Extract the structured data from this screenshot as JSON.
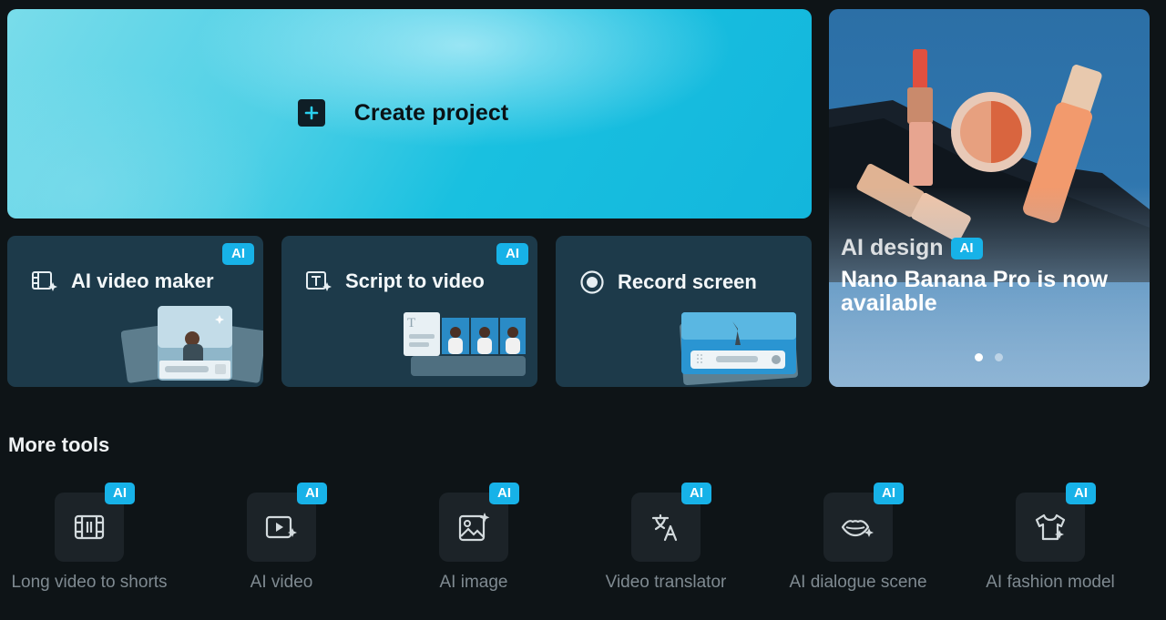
{
  "create": {
    "label": "Create project"
  },
  "cards": [
    {
      "title": "AI video maker",
      "badge": "AI",
      "icon": "film-sparkle-icon"
    },
    {
      "title": "Script to video",
      "badge": "AI",
      "icon": "text-sparkle-icon"
    },
    {
      "title": "Record screen",
      "icon": "record-icon"
    }
  ],
  "promo": {
    "tag": "AI design",
    "badge": "AI",
    "heading": "Nano Banana Pro is now available",
    "slide_count": 2,
    "active_slide": 1
  },
  "more_tools": {
    "title": "More tools",
    "items": [
      {
        "label": "Long video to shorts",
        "badge": "AI",
        "icon": "film-strip-icon"
      },
      {
        "label": "AI video",
        "badge": "AI",
        "icon": "video-play-sparkle-icon"
      },
      {
        "label": "AI image",
        "badge": "AI",
        "icon": "image-sparkle-icon"
      },
      {
        "label": "Video translator",
        "badge": "AI",
        "icon": "translate-icon"
      },
      {
        "label": "AI dialogue scene",
        "badge": "AI",
        "icon": "lips-sparkle-icon"
      },
      {
        "label": "AI fashion model",
        "badge": "AI",
        "icon": "shirt-sparkle-icon"
      }
    ]
  },
  "colors": {
    "background": "#0e1417",
    "card": "#1d3a4a",
    "badge": "#17b2e8",
    "tile": "#1c2328"
  }
}
